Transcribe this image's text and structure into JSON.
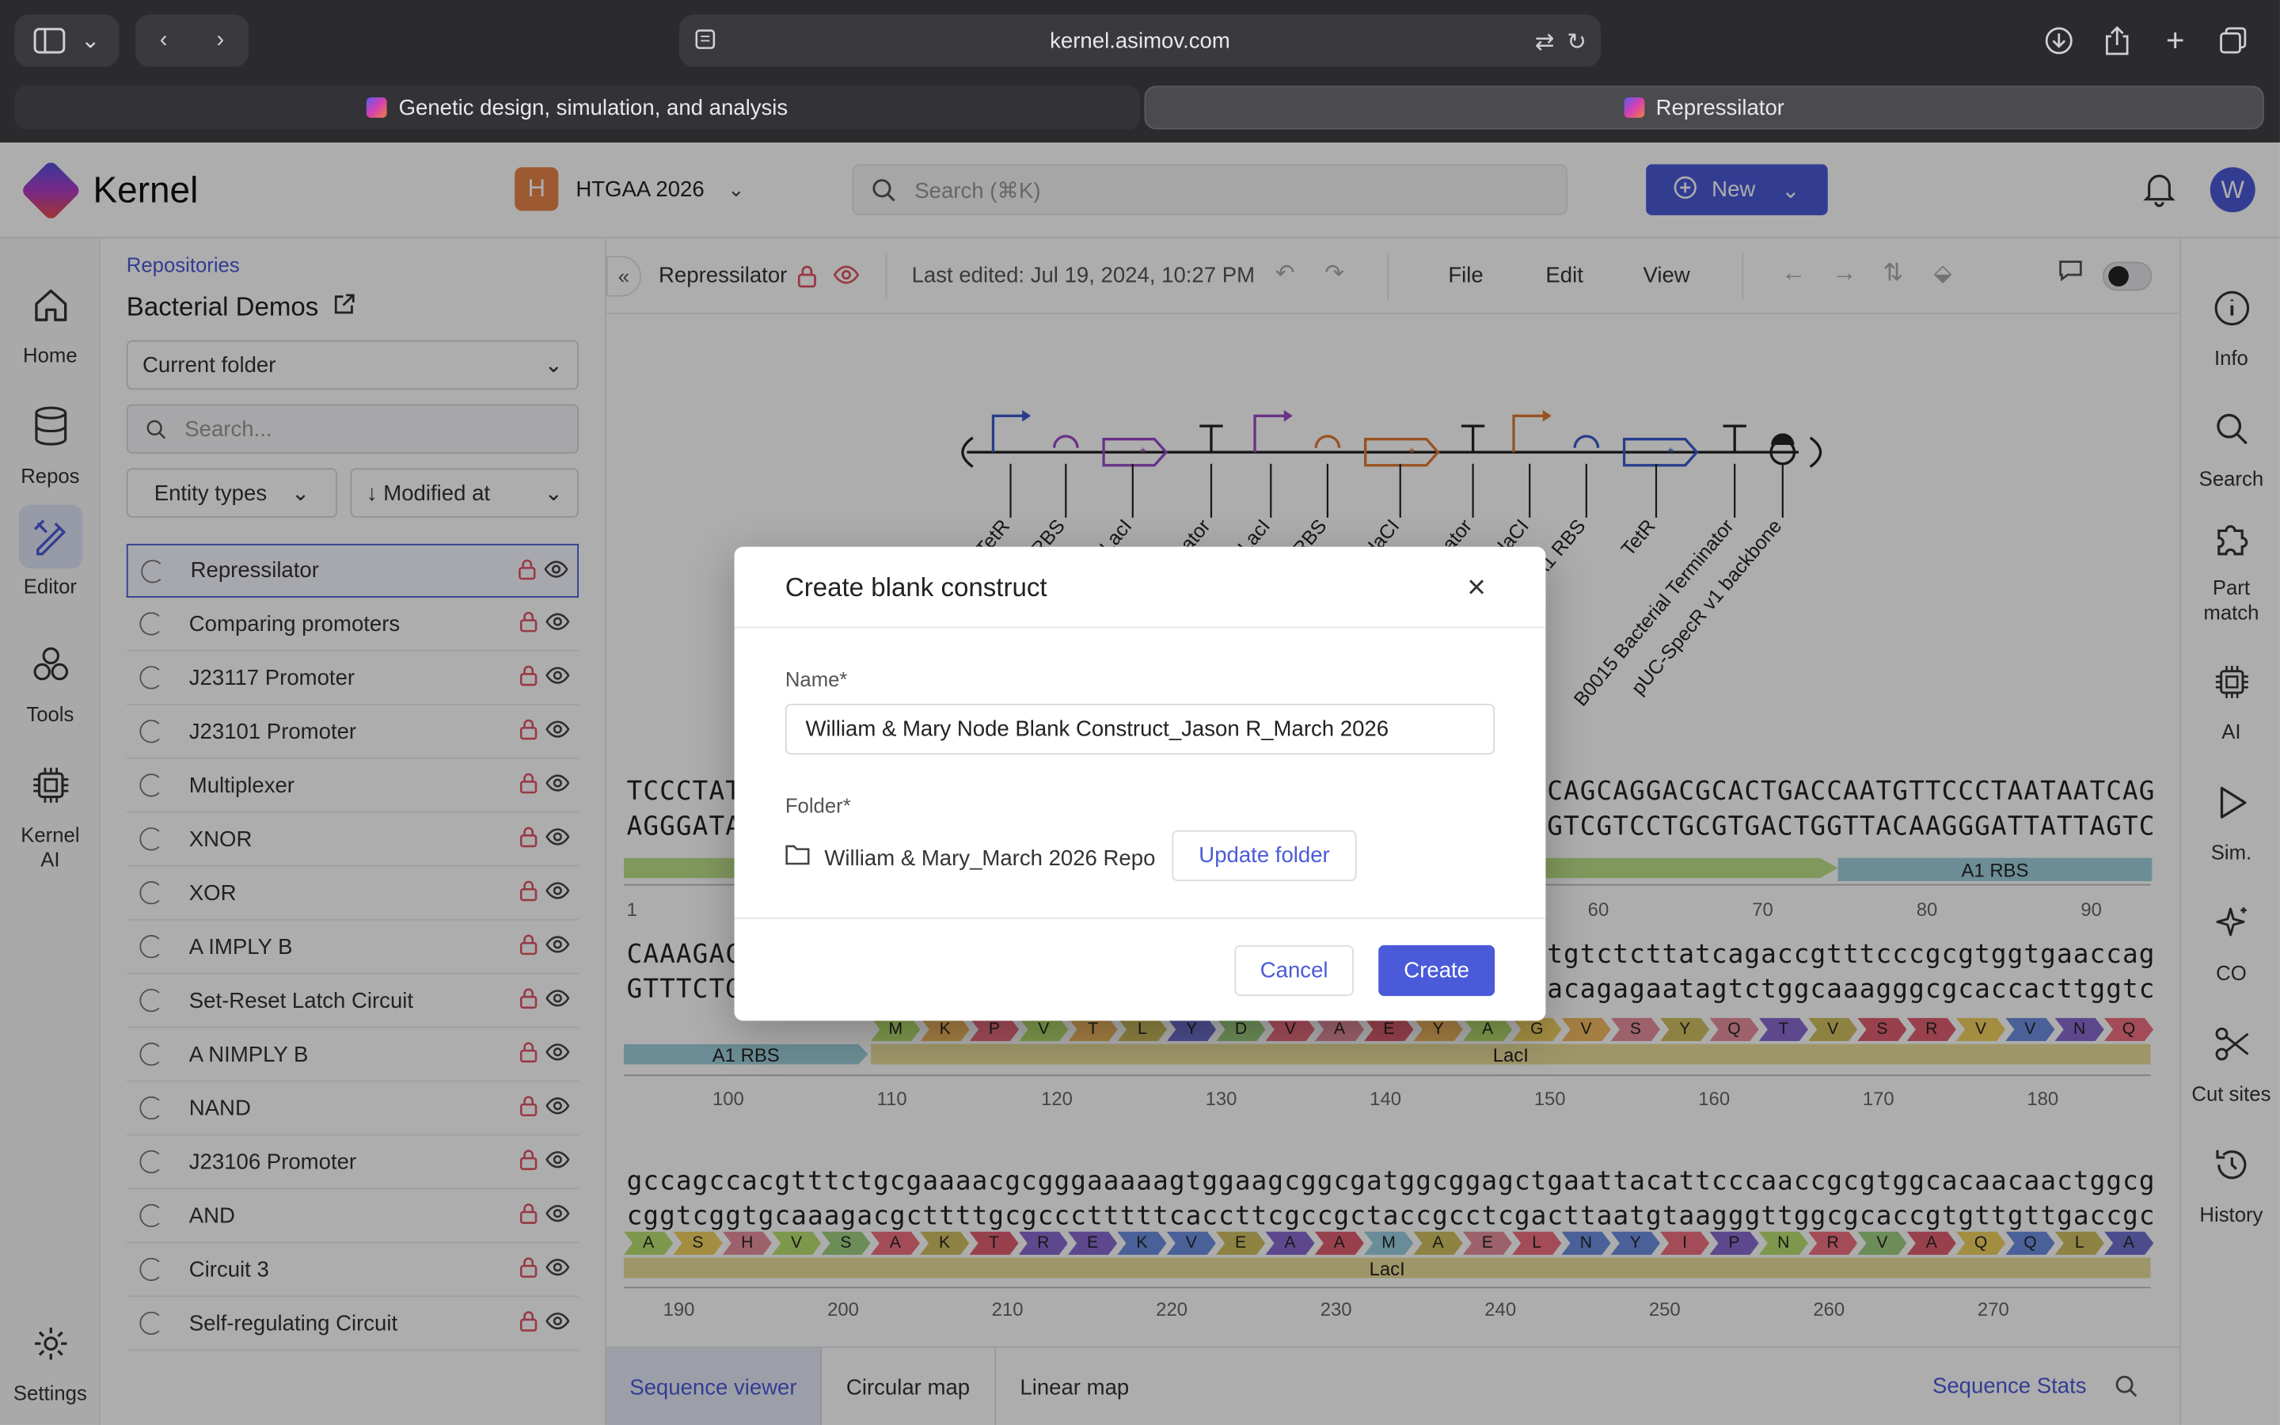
{
  "browser": {
    "url": "kernel.asimov.com",
    "tabs": [
      {
        "label": "Genetic design, simulation, and analysis"
      },
      {
        "label": "Repressilator"
      }
    ]
  },
  "header": {
    "app_name": "Kernel",
    "workspace_initial": "H",
    "workspace_name": "HTGAA 2026",
    "search_placeholder": "Search (⌘K)",
    "new_button": "New",
    "user_initial": "W"
  },
  "leftnav": {
    "items": [
      {
        "label": "Home"
      },
      {
        "label": "Repos"
      },
      {
        "label": "Editor"
      },
      {
        "label": "Tools"
      },
      {
        "label": "Kernel AI"
      },
      {
        "label": "Settings"
      }
    ]
  },
  "browser_panel": {
    "breadcrumb": "Repositories",
    "title": "Bacterial Demos",
    "folder_select": "Current folder",
    "search_placeholder": "Search...",
    "filter_entity": "Entity types",
    "filter_sort": "↓ Modified at",
    "items": [
      "Repressilator",
      "Comparing promoters",
      "J23117 Promoter",
      "J23101 Promoter",
      "Multiplexer",
      "XNOR",
      "XOR",
      "A IMPLY B",
      "Set-Reset Latch Circuit",
      "A NIMPLY B",
      "NAND",
      "J23106 Promoter",
      "AND",
      "Circuit 3",
      "Self-regulating Circuit"
    ]
  },
  "editor": {
    "doc_title": "Repressilator",
    "last_edited": "Last edited: Jul 19, 2024, 10:27 PM",
    "menus": [
      "File",
      "Edit",
      "View"
    ],
    "parts": [
      "pTetR",
      "A1 RBS",
      "LacI",
      "Terminator",
      "pLacI",
      "A1 RBS",
      "LambdaCI",
      "Terminator",
      "pLambdaCI",
      "A1 RBS",
      "TetR",
      "B0015 Bacterial Terminator",
      "pUC-SpecR v1 backbone"
    ],
    "seq_rows": [
      {
        "top_left": "TCCCTAT",
        "bottom_left": "AGGGATA",
        "top_right": "CAGCAGGACGCACTGACCAATGTTCCCTAATAATCAG",
        "bottom_right": "GTCGTCCTGCGTGACTGGTTACAAGGGATTATTAGTC",
        "feature": "A1 RBS",
        "ticks": [
          "1",
          "60",
          "70",
          "80",
          "90"
        ]
      },
      {
        "top_left": "CAAAGAC",
        "bottom_left": "GTTTCTG",
        "top_right": "tgtctcttatcagaccgtttcccgcgtggtgaaccag",
        "bottom_right": "acagagaatagtctggcaaagggcgcaccacttggtc",
        "feature_a": "A1 RBS",
        "feature_b": "LacI",
        "ticks": [
          "100",
          "110",
          "120",
          "130",
          "140",
          "150",
          "160",
          "170",
          "180"
        ],
        "aa": [
          "M",
          "K",
          "P",
          "V",
          "T",
          "L",
          "Y",
          "D",
          "V",
          "A",
          "E",
          "Y",
          "A",
          "G",
          "V",
          "S",
          "Y",
          "Q",
          "T",
          "V",
          "S",
          "R",
          "V",
          "V",
          "N",
          "Q"
        ]
      },
      {
        "top": "gccagccacgtttctgcgaaaacgcgggaaaaagtggaagcggcgatggcggagctgaattacattcccaaccgcgtggcacaacaactggcg",
        "bottom": "cggtcggtgcaaagacgcttttgcgccctttttcaccttcgccgctaccgcctcgacttaatgtaagggttggcgcaccgtgttgttgaccgc",
        "feature": "LacI",
        "ticks": [
          "190",
          "200",
          "210",
          "220",
          "230",
          "240",
          "250",
          "260",
          "270"
        ],
        "aa": [
          "A",
          "S",
          "H",
          "V",
          "S",
          "A",
          "K",
          "T",
          "R",
          "E",
          "K",
          "V",
          "E",
          "A",
          "A",
          "M",
          "A",
          "E",
          "L",
          "N",
          "Y",
          "I",
          "P",
          "N",
          "R",
          "V",
          "A",
          "Q",
          "Q",
          "L",
          "A"
        ]
      }
    ],
    "bottom_tabs": [
      "Sequence viewer",
      "Circular map",
      "Linear map"
    ],
    "seq_stats": "Sequence Stats"
  },
  "rightnav": {
    "items": [
      {
        "label": "Info"
      },
      {
        "label": "Search"
      },
      {
        "label": "Part match"
      },
      {
        "label": "AI"
      },
      {
        "label": "Sim."
      },
      {
        "label": "CO"
      },
      {
        "label": "Cut sites"
      },
      {
        "label": "History"
      }
    ]
  },
  "modal": {
    "title": "Create blank construct",
    "name_label": "Name*",
    "name_value": "William & Mary Node Blank Construct_Jason R_March 2026",
    "folder_label": "Folder*",
    "folder_value": "William & Mary_March 2026 Repo",
    "update_folder": "Update folder",
    "cancel": "Cancel",
    "create": "Create"
  },
  "colors": {
    "accent": "#4a5ad8",
    "aa_palette": [
      "#f0d060",
      "#6e8ee0",
      "#e890a0",
      "#a0d080",
      "#f2b860",
      "#b8e070",
      "#8a6ad0",
      "#e06070",
      "#9ad0e0",
      "#d0c060",
      "#f07080",
      "#7070d0"
    ]
  }
}
